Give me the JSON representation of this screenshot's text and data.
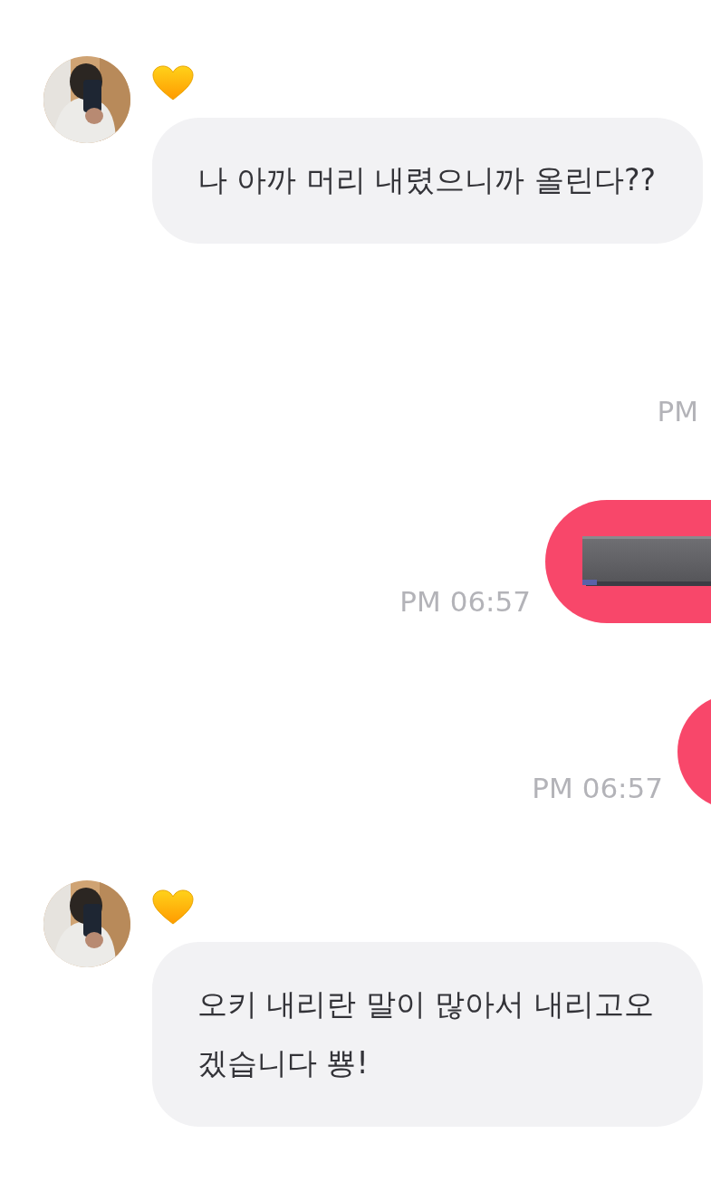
{
  "messages": [
    {
      "kind": "incoming",
      "heart": true,
      "text": "나 아까 머리 내렸으니까 올린다??"
    },
    {
      "kind": "outgoing",
      "time": "PM"
    },
    {
      "kind": "outgoing",
      "bubble": {
        "kind": "bar"
      },
      "time": "PM 06:57"
    },
    {
      "kind": "outgoing",
      "bubble": {
        "kind": "round"
      },
      "time": "PM 06:57"
    },
    {
      "kind": "incoming",
      "heart": true,
      "text": "오키 내리란 말이 많아서 내리고오겠습니다 뿅!"
    }
  ]
}
